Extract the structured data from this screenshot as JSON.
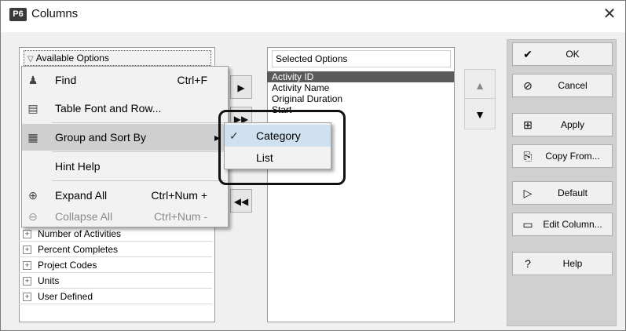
{
  "window": {
    "title": "Columns",
    "app_badge": "P6",
    "close_glyph": "✕"
  },
  "available": {
    "header": "Available Options",
    "chevron": "▽",
    "items": [
      {
        "label": "Number of Activities"
      },
      {
        "label": "Percent Completes"
      },
      {
        "label": "Project Codes"
      },
      {
        "label": "Units"
      },
      {
        "label": "User Defined"
      }
    ]
  },
  "transfer": {
    "add": "▶",
    "add_all": "▶▶",
    "remove_all": "◀◀"
  },
  "selected": {
    "header": "Selected Options",
    "items": [
      {
        "label": "Activity ID",
        "selected": true
      },
      {
        "label": "Activity Name"
      },
      {
        "label": "Original Duration"
      },
      {
        "label": "Start"
      }
    ],
    "up": "▲",
    "down": "▼"
  },
  "buttons": [
    {
      "label": "OK",
      "icon": "✔"
    },
    {
      "label": "Cancel",
      "icon": "⊘"
    },
    {
      "label": "Apply",
      "icon": "⊞"
    },
    {
      "label": "Copy From...",
      "icon": "⎘"
    },
    {
      "label": "Default",
      "icon": "▷"
    },
    {
      "label": "Edit Column...",
      "icon": "▭"
    },
    {
      "label": "Help",
      "icon": "?"
    }
  ],
  "context_menu": {
    "items": [
      {
        "label": "Find",
        "shortcut": "Ctrl+F",
        "icon": "♟"
      },
      {
        "label": "Table Font and Row...",
        "icon": "▤"
      },
      {
        "label": "Group and Sort By",
        "icon": "▦",
        "submenu_arrow": "▸"
      },
      {
        "label": "Hint Help"
      },
      {
        "label": "Expand All",
        "shortcut": "Ctrl+Num +",
        "icon": "⊕"
      },
      {
        "label": "Collapse All",
        "shortcut": "Ctrl+Num -",
        "icon": "⊖"
      }
    ]
  },
  "submenu": {
    "items": [
      {
        "label": "Category",
        "checked": "✓"
      },
      {
        "label": "List"
      }
    ]
  },
  "colors": {
    "highlight": "#5a5a5a",
    "right_panel": "#d0d0d0"
  }
}
